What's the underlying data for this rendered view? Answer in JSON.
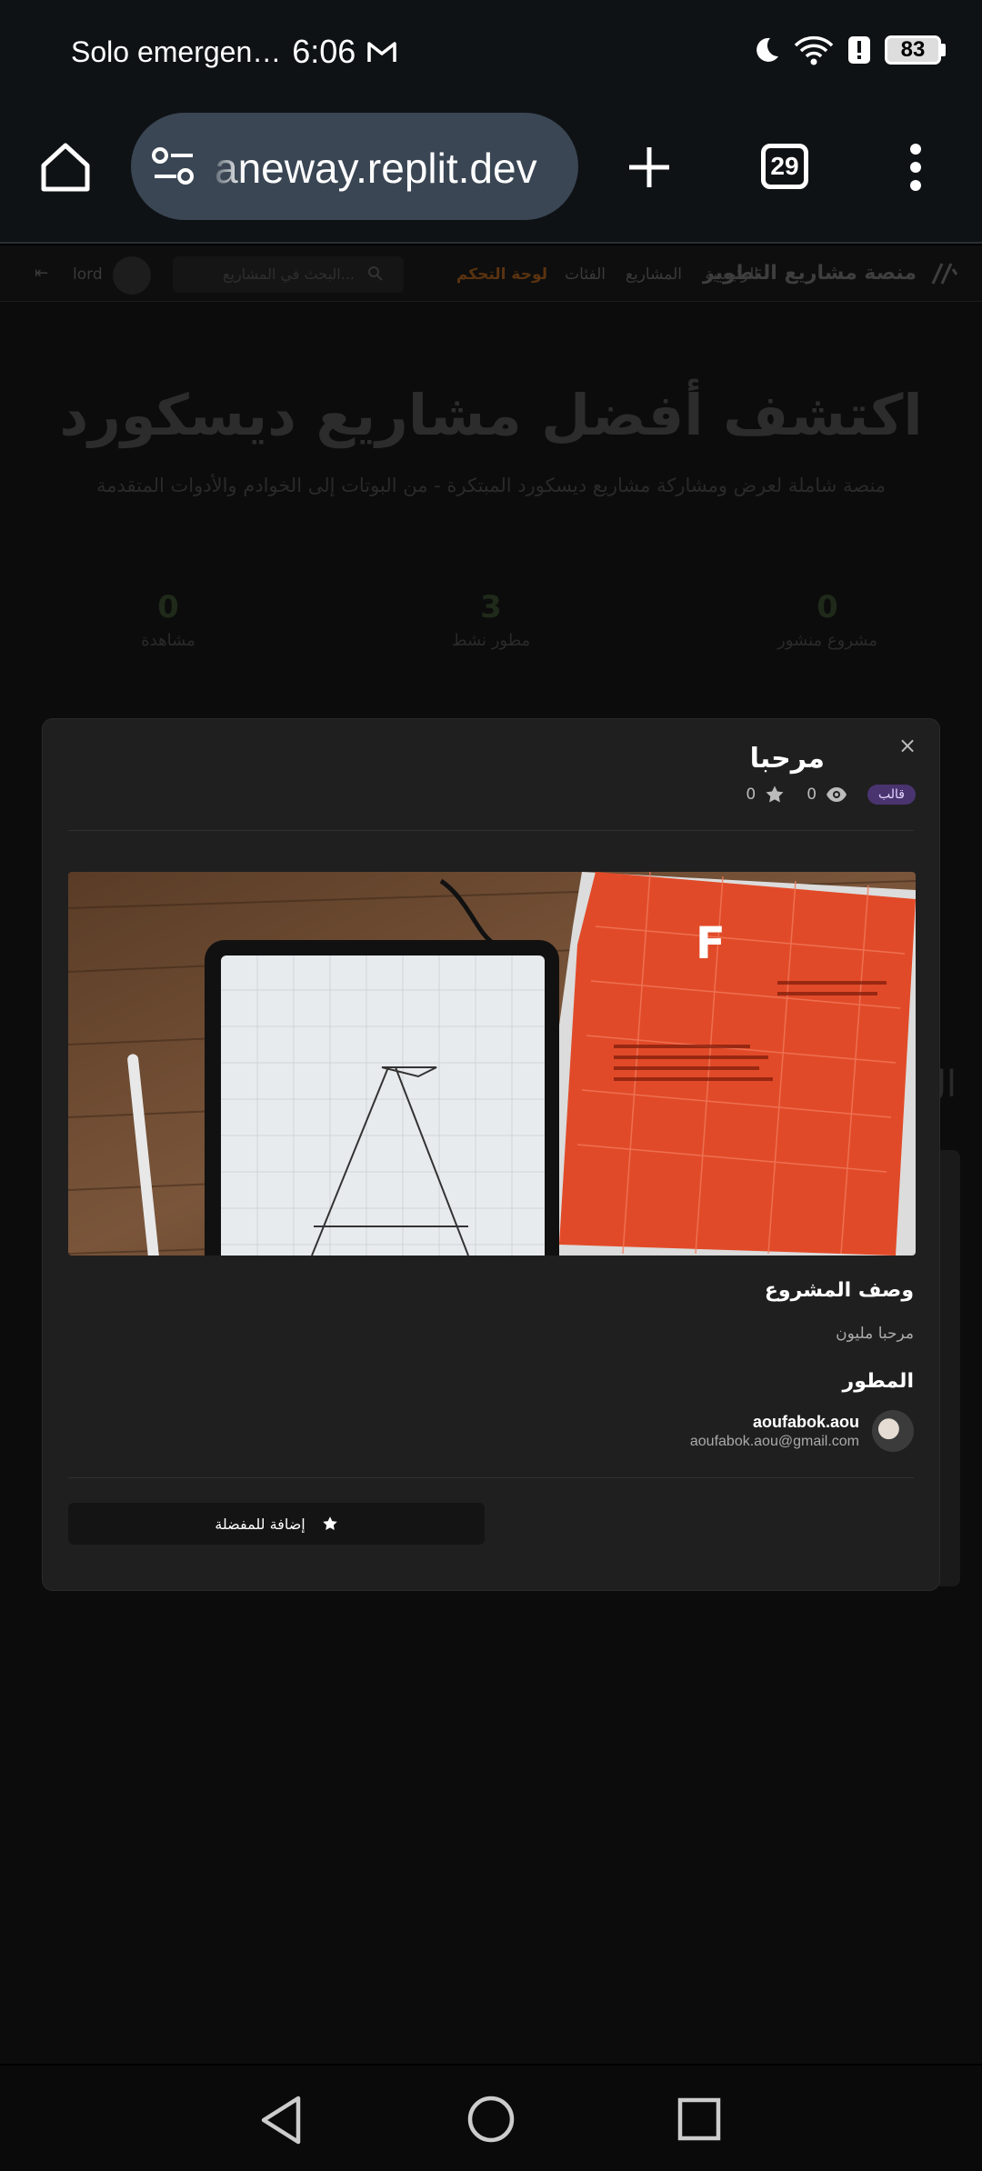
{
  "status_bar": {
    "carrier": "Solo emergen…",
    "time": "6:06",
    "battery": "83"
  },
  "browser": {
    "url": "aneway.replit.dev",
    "tab_count": "29"
  },
  "page": {
    "nav": {
      "brand": "منصة مشاريع التطوير",
      "links": [
        "الرئيسية",
        "المشاريع",
        "الفئات",
        "لوحة التحكم"
      ],
      "search_placeholder": "البحث في المشاريع...",
      "username": "lord"
    },
    "hero": {
      "title": "اكتشف أفضل مشاريع ديسكورد",
      "subtitle": "منصة شاملة لعرض ومشاركة مشاريع ديسكورد المبتكرة - من البوتات إلى الخوادم والأدوات المتقدمة"
    },
    "stats": [
      {
        "value": "0",
        "label": "مشروع منشور"
      },
      {
        "value": "3",
        "label": "مطور نشط"
      },
      {
        "value": "0",
        "label": "مشاهدة"
      }
    ],
    "edge_text": "ال"
  },
  "modal": {
    "title": "مرحبا",
    "badge": "قالب",
    "views": "0",
    "stars": "0",
    "description_heading": "وصف المشروع",
    "description": "مرحبا مليون",
    "developer_heading": "المطور",
    "developer_name": "aoufabok.aou",
    "developer_email": "aoufabok.aou@gmail.com",
    "favorite_button": "إضافة للمفضلة",
    "close": "×"
  },
  "colors": {
    "accent_purple": "#4a3470",
    "modal_bg": "#1f1f1f",
    "url_pill": "#3a4654",
    "dashboard_link": "#5a3310"
  }
}
